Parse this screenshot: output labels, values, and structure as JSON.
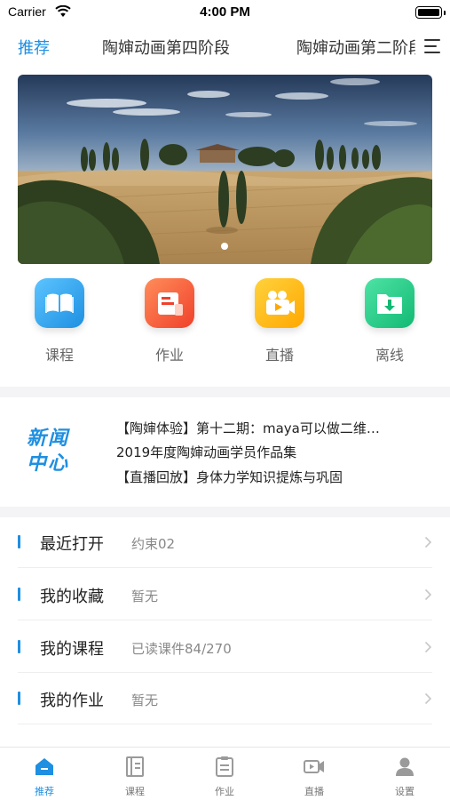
{
  "status_bar": {
    "carrier": "Carrier",
    "time": "4:00 PM"
  },
  "top_tabs": [
    {
      "label": "推荐",
      "active": true
    },
    {
      "label": "陶婶动画第四阶段",
      "active": false
    },
    {
      "label": "陶婶动画第二阶段",
      "active": false
    }
  ],
  "banner": {
    "slide_index": 1,
    "slide_count": 1
  },
  "quick_actions": [
    {
      "label": "课程",
      "icon": "book-icon",
      "color": "#1e8fe1"
    },
    {
      "label": "作业",
      "icon": "document-icon",
      "color": "#f0402a"
    },
    {
      "label": "直播",
      "icon": "video-camera-icon",
      "color": "#ffa800"
    },
    {
      "label": "离线",
      "icon": "download-folder-icon",
      "color": "#12b973"
    }
  ],
  "news": {
    "logo_line1": "新闻",
    "logo_line2": "中心",
    "items": [
      "【陶婶体验】第十二期：maya可以做二维…",
      "2019年度陶婶动画学员作品集",
      "【直播回放】身体力学知识提炼与巩固"
    ]
  },
  "list": [
    {
      "title": "最近打开",
      "value": "约束02"
    },
    {
      "title": "我的收藏",
      "value": "暂无"
    },
    {
      "title": "我的课程",
      "value": "已读课件84/270"
    },
    {
      "title": "我的作业",
      "value": "暂无"
    }
  ],
  "tab_bar": [
    {
      "label": "推荐",
      "icon": "home-icon",
      "active": true
    },
    {
      "label": "课程",
      "icon": "course-icon",
      "active": false
    },
    {
      "label": "作业",
      "icon": "clipboard-icon",
      "active": false
    },
    {
      "label": "直播",
      "icon": "video-icon",
      "active": false
    },
    {
      "label": "设置",
      "icon": "person-icon",
      "active": false
    }
  ],
  "colors": {
    "accent": "#1e8fe1",
    "divider": "#f4f4f6"
  }
}
